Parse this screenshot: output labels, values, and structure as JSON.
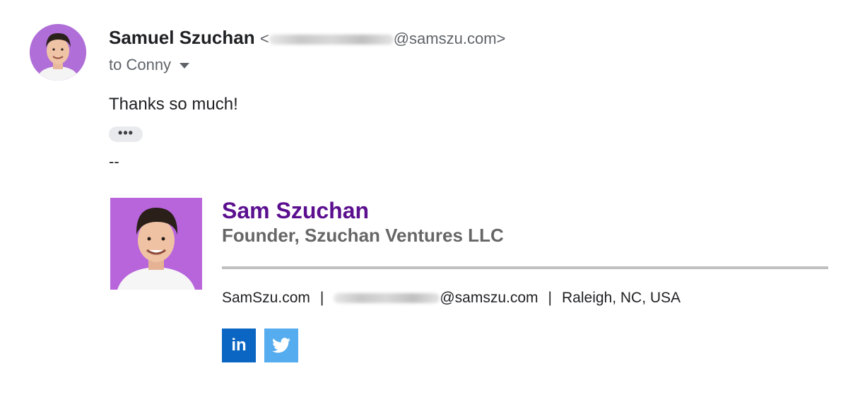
{
  "email": {
    "sender_name": "Samuel Szuchan",
    "sender_address_prefix": "<",
    "sender_address_domain": "@samszu.com>",
    "recipients": "to Conny",
    "body": "Thanks so much!",
    "trimmed_content_label": "•••",
    "signature_delimiter": "--"
  },
  "signature": {
    "name": "Sam Szuchan",
    "title": "Founder, Szuchan Ventures LLC",
    "website": "SamSzu.com",
    "separator": "|",
    "email_domain": "@samszu.com",
    "location": "Raleigh, NC, USA",
    "social": [
      {
        "name": "linkedin-icon",
        "glyph": "in",
        "color": "#0a66c2"
      },
      {
        "name": "twitter-icon",
        "color": "#55acee"
      }
    ],
    "name_color": "#5b0f8f",
    "title_color": "#666666"
  }
}
